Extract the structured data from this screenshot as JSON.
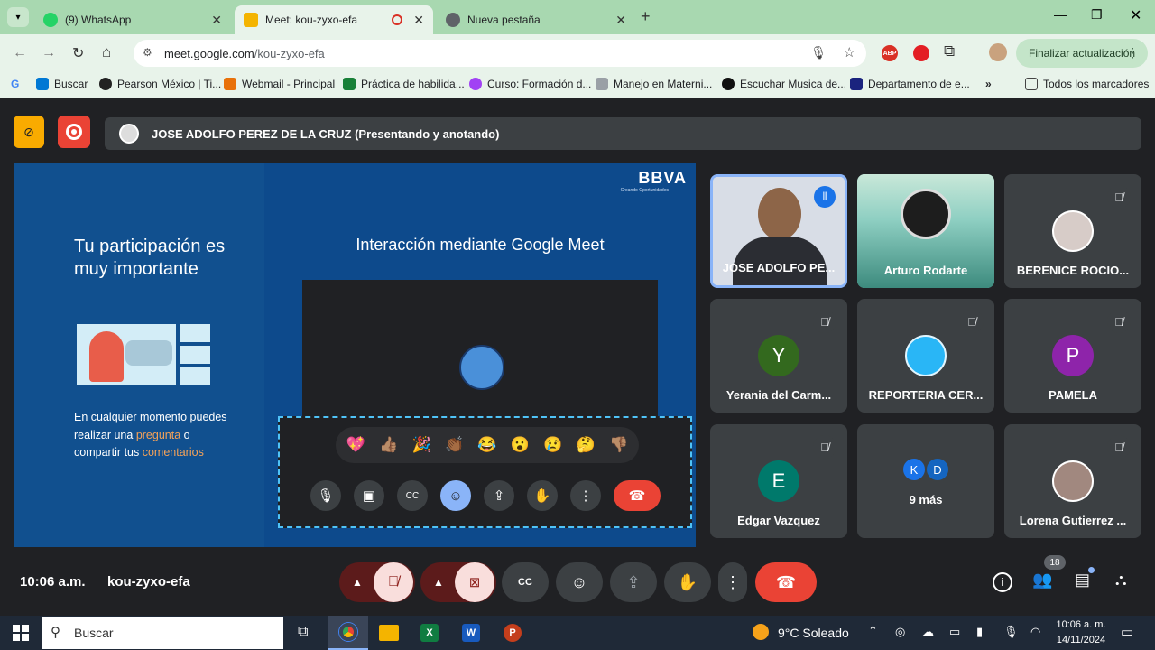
{
  "tabs": [
    {
      "label": "(9) WhatsApp"
    },
    {
      "label": "Meet: kou-zyxo-efa"
    },
    {
      "label": "Nueva pestaña"
    }
  ],
  "address": {
    "host": "meet.google.com",
    "path": "/kou-zyxo-efa"
  },
  "update_button": "Finalizar actualización",
  "bookmarks": [
    {
      "label": "Buscar"
    },
    {
      "label": "Pearson México | Ti..."
    },
    {
      "label": "Webmail - Principal"
    },
    {
      "label": "Práctica de habilida..."
    },
    {
      "label": "Curso: Formación d..."
    },
    {
      "label": "Manejo en Materni..."
    },
    {
      "label": "Escuchar Musica de..."
    },
    {
      "label": "Departamento de e..."
    },
    {
      "label": "Todos los marcadores"
    }
  ],
  "presenter_bar": "JOSE ADOLFO PEREZ DE LA CRUZ (Presentando y anotando)",
  "slide": {
    "left_title": "Tu participación es muy importante",
    "left_text_1": "En cualquier momento puedes realizar una",
    "left_text_link1": "pregunta",
    "left_text_2": "o compartir tus",
    "left_text_link2": "comentarios",
    "brand": "BBVA",
    "brand_sub": "Creando Oportunidades",
    "right_title": "Interacción mediante Google Meet",
    "emojis": [
      "💖",
      "👍🏽",
      "🎉",
      "👏🏾",
      "😂",
      "😮",
      "😢",
      "🤔",
      "👎🏽"
    ]
  },
  "participants": [
    {
      "name": "JOSE ADOLFO PE...",
      "type": "video"
    },
    {
      "name": "Arturo Rodarte",
      "type": "image"
    },
    {
      "name": "BERENICE ROCIO...",
      "type": "photo",
      "muted": true
    },
    {
      "name": "Yerania del Carm...",
      "initial": "Y",
      "color": "#33691e",
      "muted": true
    },
    {
      "name": "REPORTERIA CER...",
      "type": "logo",
      "muted": true
    },
    {
      "name": "PAMELA",
      "initial": "P",
      "color": "#8e24aa",
      "muted": true
    },
    {
      "name": "Edgar Vazquez",
      "initial": "E",
      "color": "#00796b",
      "muted": true
    },
    {
      "name": "9 más",
      "initials": [
        "K",
        "D"
      ]
    },
    {
      "name": "Lorena Gutierrez ...",
      "type": "photo",
      "muted": true
    }
  ],
  "meeting": {
    "time": "10:06 a.m.",
    "code": "kou-zyxo-efa",
    "people_count": "18"
  },
  "taskbar": {
    "search": "Buscar",
    "weather": "9°C  Soleado",
    "time": "10:06 a. m.",
    "date": "14/11/2024"
  }
}
